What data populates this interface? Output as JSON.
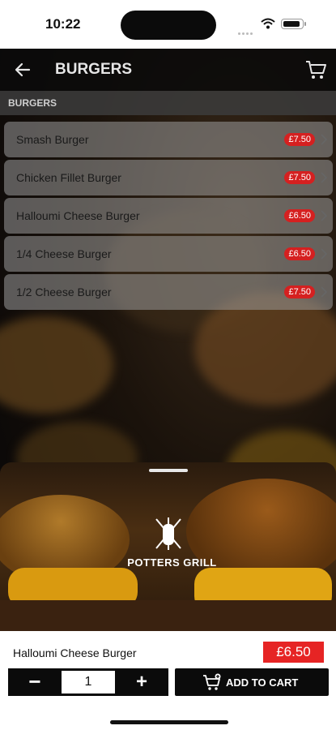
{
  "status": {
    "time": "10:22"
  },
  "header": {
    "title": "BURGERS",
    "back_icon": "arrow-left-icon",
    "cart_icon": "cart-icon"
  },
  "section": {
    "label": "BURGERS"
  },
  "menu": {
    "items": [
      {
        "name": "Smash Burger",
        "price": "£7.50"
      },
      {
        "name": "Chicken Fillet Burger",
        "price": "£7.50"
      },
      {
        "name": "Halloumi Cheese Burger",
        "price": "£6.50"
      },
      {
        "name": "1/4 Cheese Burger",
        "price": "£6.50"
      },
      {
        "name": "1/2 Cheese Burger",
        "price": "£7.50"
      }
    ]
  },
  "sheet": {
    "brand": "POTTERS GRILL"
  },
  "selection": {
    "name": "Halloumi Cheese Burger",
    "price": "£6.50",
    "quantity": "1",
    "minus": "−",
    "plus": "+",
    "add_to_cart": "ADD TO CART"
  },
  "colors": {
    "accent_red": "#e62424",
    "badge_red": "#d52020",
    "dark": "#0b0b0b"
  }
}
